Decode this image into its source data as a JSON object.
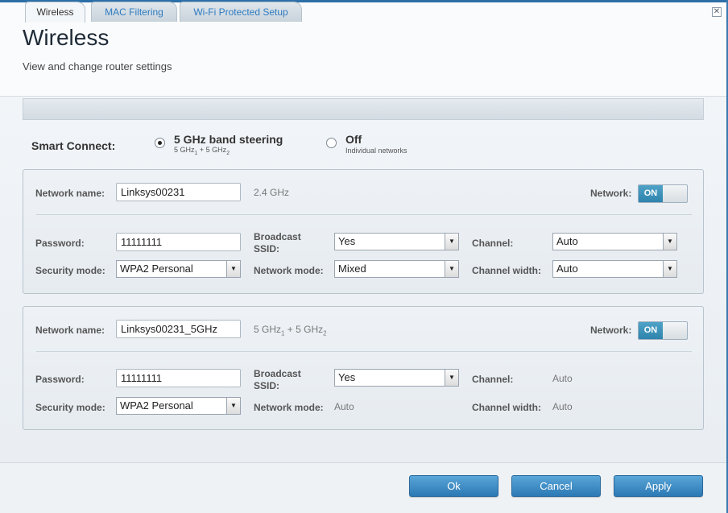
{
  "header": {
    "title": "Wireless",
    "subtitle": "View and change router settings",
    "close_glyph": "✕"
  },
  "tabs": [
    {
      "label": "Wireless",
      "active": true
    },
    {
      "label": "MAC Filtering",
      "active": false
    },
    {
      "label": "Wi-Fi Protected Setup",
      "active": false
    }
  ],
  "smart_connect": {
    "label": "Smart Connect:",
    "options": [
      {
        "label": "5 GHz band steering",
        "sub": "5 GHz",
        "sub_idx1": "1",
        "sub_mid": " + 5 GHz",
        "sub_idx2": "2",
        "checked": true
      },
      {
        "label": "Off",
        "sub": "Individual networks",
        "checked": false
      }
    ]
  },
  "network1": {
    "network_name_label": "Network name:",
    "network_name": "Linksys00231",
    "band": "2.4 GHz",
    "network_label": "Network:",
    "toggle": "ON",
    "password_label": "Password:",
    "password": "11111111",
    "broadcast_label_1": "Broadcast",
    "broadcast_label_2": "SSID:",
    "broadcast": "Yes",
    "channel_label": "Channel:",
    "channel": "Auto",
    "security_label": "Security mode:",
    "security": "WPA2 Personal",
    "mode_label": "Network mode:",
    "mode": "Mixed",
    "width_label": "Channel width:",
    "width": "Auto"
  },
  "network2": {
    "network_name_label": "Network name:",
    "network_name": "Linksys00231_5GHz",
    "band_a": "5 GHz",
    "band_i1": "1",
    "band_b": " + 5 GHz",
    "band_i2": "2",
    "network_label": "Network:",
    "toggle": "ON",
    "password_label": "Password:",
    "password": "11111111",
    "broadcast_label_1": "Broadcast",
    "broadcast_label_2": "SSID:",
    "broadcast": "Yes",
    "channel_label": "Channel:",
    "channel": "Auto",
    "security_label": "Security mode:",
    "security": "WPA2 Personal",
    "mode_label": "Network mode:",
    "mode": "Auto",
    "width_label": "Channel width:",
    "width": "Auto"
  },
  "footer": {
    "ok": "Ok",
    "cancel": "Cancel",
    "apply": "Apply"
  },
  "icons": {
    "dropdown_arrow": "▼"
  },
  "colors": {
    "accent": "#2c79b5",
    "tab_link": "#2e7bc0",
    "toggle_on": "#3a8fb9"
  }
}
